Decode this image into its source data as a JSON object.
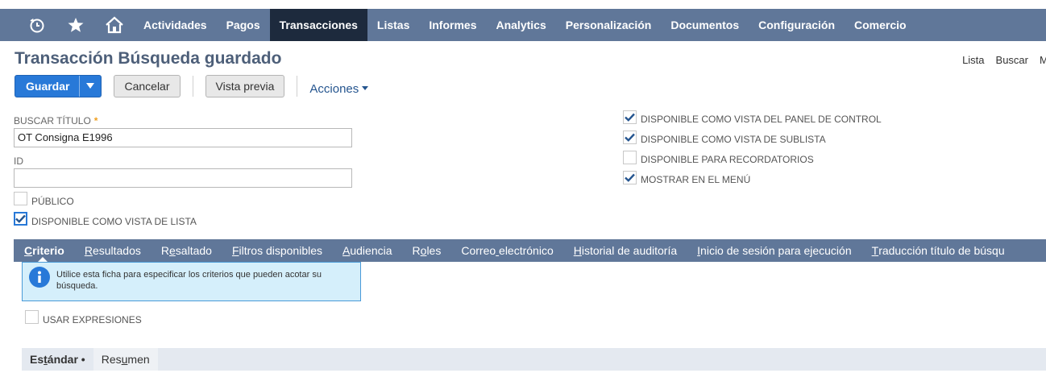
{
  "nav": {
    "icons": [
      "recent-icon",
      "star-icon",
      "home-icon"
    ],
    "items": [
      "Actividades",
      "Pagos",
      "Transacciones",
      "Listas",
      "Informes",
      "Analytics",
      "Personalización",
      "Documentos",
      "Configuración",
      "Comercio"
    ],
    "active": "Transacciones"
  },
  "page": {
    "title": "Transacción Búsqueda guardado",
    "top_links": [
      "Lista",
      "Buscar",
      "M"
    ]
  },
  "toolbar": {
    "save_label": "Guardar",
    "cancel_label": "Cancelar",
    "preview_label": "Vista previa",
    "actions_label": "Acciones"
  },
  "form": {
    "title_label": "BUSCAR TÍTULO",
    "title_required": "*",
    "title_value": "OT Consigna E1996",
    "id_label": "ID",
    "id_value": "",
    "public_label": "PÚBLICO",
    "public_checked": false,
    "list_view_label": "DISPONIBLE COMO VISTA DE LISTA",
    "list_view_checked": true,
    "dashboard_label": "DISPONIBLE COMO VISTA DEL PANEL DE CONTROL",
    "dashboard_checked": true,
    "sublist_label": "DISPONIBLE COMO VISTA DE SUBLISTA",
    "sublist_checked": true,
    "reminders_label": "DISPONIBLE PARA RECORDATORIOS",
    "reminders_checked": false,
    "menu_label": "MOSTRAR EN EL MENÚ",
    "menu_checked": true
  },
  "tabs": {
    "items": [
      {
        "pre": "",
        "u": "C",
        "post": "riterio"
      },
      {
        "pre": "",
        "u": "R",
        "post": "esultados"
      },
      {
        "pre": "R",
        "u": "e",
        "post": "saltado"
      },
      {
        "pre": "",
        "u": "F",
        "post": "iltros disponibles"
      },
      {
        "pre": "",
        "u": "A",
        "post": "udiencia"
      },
      {
        "pre": "R",
        "u": "o",
        "post": "les"
      },
      {
        "pre": "Correo",
        "u": " ",
        "post": "electrónico"
      },
      {
        "pre": "",
        "u": "H",
        "post": "istorial de auditoría"
      },
      {
        "pre": "",
        "u": "I",
        "post": "nicio de sesión para ejecución"
      },
      {
        "pre": "",
        "u": "T",
        "post": "raducción título de búsqu"
      }
    ]
  },
  "info": {
    "text": "Utilice esta ficha para especificar los criterios que pueden acotar su búsqueda."
  },
  "expressions": {
    "label": "USAR EXPRESIONES",
    "checked": false
  },
  "subtabs": {
    "standard_pre": "Es",
    "standard_u": "t",
    "standard_post": "ándar",
    "summary_pre": "Res",
    "summary_u": "u",
    "summary_post": "men"
  },
  "colors": {
    "nav_bg": "#607799",
    "nav_active": "#1d2a3d",
    "primary": "#2879d8",
    "title": "#4d5f79",
    "info_bg": "#d5effb"
  }
}
